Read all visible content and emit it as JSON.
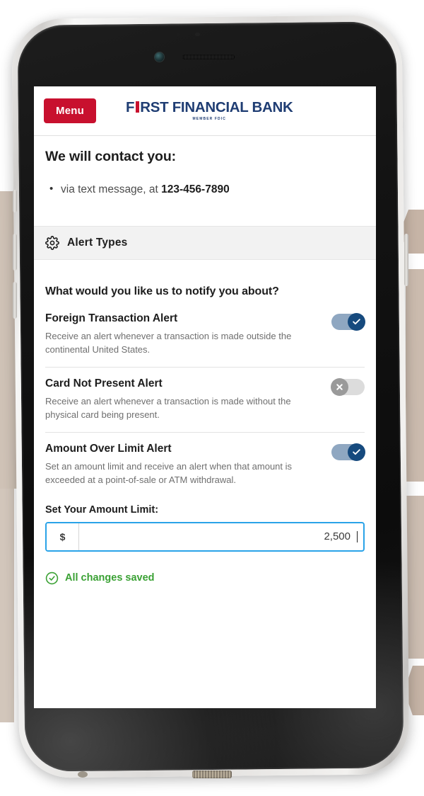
{
  "header": {
    "menu_label": "Menu",
    "brand_part1": "F",
    "brand_part2": "RST FINANCIAL BANK",
    "brand_subtitle": "MEMBER FDIC",
    "brand_color": "#1f3d73",
    "menu_color": "#c8102e"
  },
  "contact": {
    "title": "We will contact you:",
    "method_prefix": "via text message, at ",
    "phone": "123-456-7890"
  },
  "section": {
    "icon": "gear-icon",
    "title": "Alert Types"
  },
  "prompt": "What would you like us to notify you about?",
  "alerts": [
    {
      "name": "Foreign Transaction Alert",
      "description": "Receive an alert whenever a transaction is made outside the continental United States.",
      "state": "on",
      "toggle_icon": "check-icon"
    },
    {
      "name": "Card Not Present Alert",
      "description": "Receive an alert whenever a transaction is made without the physical card being present.",
      "state": "off",
      "toggle_icon": "x-icon"
    },
    {
      "name": "Amount Over Limit Alert",
      "description": "Set an amount limit and receive an alert when that amount is exceeded at a point-of-sale or ATM withdrawal.",
      "state": "on",
      "toggle_icon": "check-icon"
    }
  ],
  "amount_limit": {
    "label": "Set Your Amount Limit:",
    "currency_symbol": "$",
    "value": "2,500",
    "placeholder": "",
    "focus_color": "#2aa3e8"
  },
  "status": {
    "icon": "check-circle-icon",
    "text": "All changes saved",
    "color": "#3aa134"
  },
  "toggle_colors": {
    "on_track": "#8fa7c1",
    "on_knob": "#164a7e",
    "off_track": "#dcdcdc",
    "off_knob": "#9a9a9a"
  }
}
